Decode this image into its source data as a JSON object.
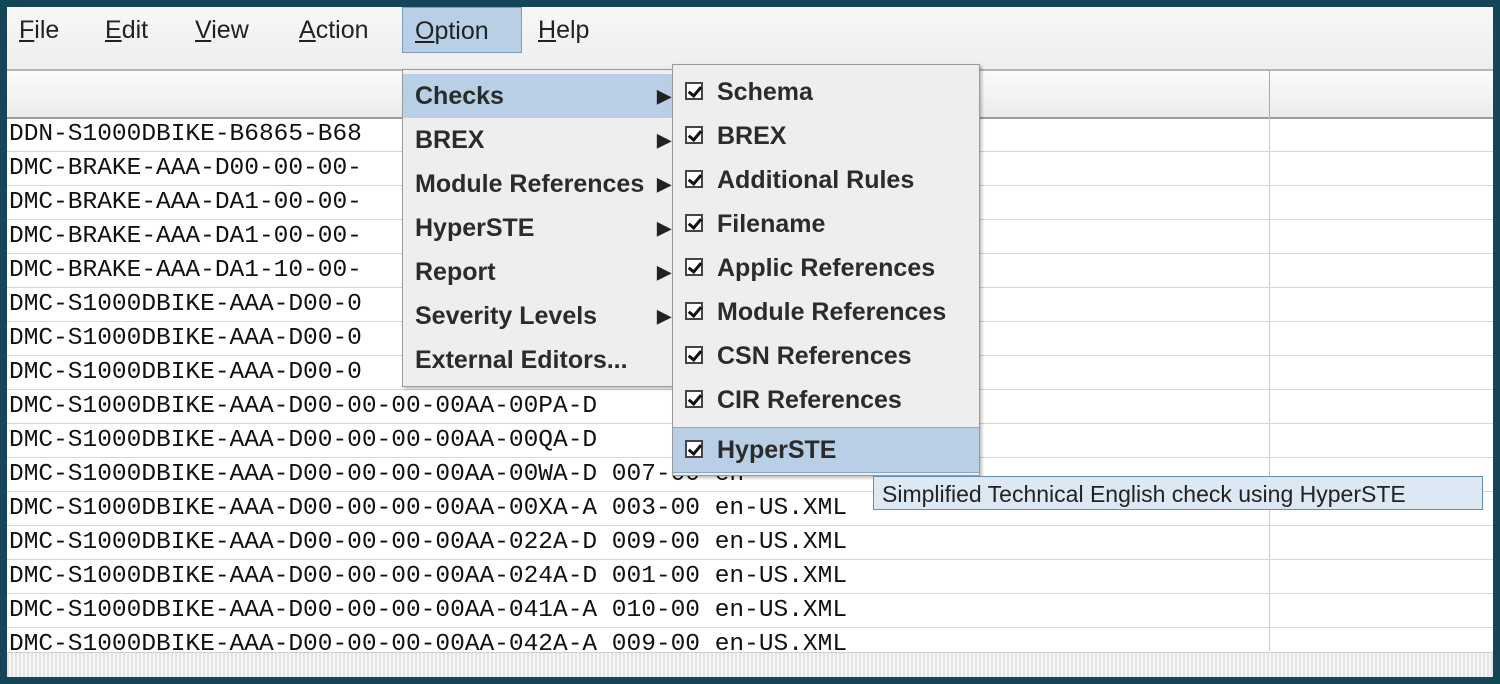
{
  "menubar": {
    "items": [
      {
        "mnemonic": "F",
        "rest": "ile"
      },
      {
        "mnemonic": "E",
        "rest": "dit"
      },
      {
        "mnemonic": "V",
        "rest": "iew"
      },
      {
        "mnemonic": "A",
        "rest": "ction"
      },
      {
        "mnemonic": "O",
        "rest": "ption"
      },
      {
        "mnemonic": "H",
        "rest": "elp"
      }
    ]
  },
  "table": {
    "rows": [
      "DDN-S1000DBIKE-B6865-B68",
      "DMC-BRAKE-AAA-D00-00-00-",
      "DMC-BRAKE-AAA-DA1-00-00-",
      "DMC-BRAKE-AAA-DA1-00-00-",
      "DMC-BRAKE-AAA-DA1-10-00-",
      "DMC-S1000DBIKE-AAA-D00-0",
      "DMC-S1000DBIKE-AAA-D00-0",
      "DMC-S1000DBIKE-AAA-D00-0",
      "DMC-S1000DBIKE-AAA-D00-00-00-00AA-00PA-D",
      "DMC-S1000DBIKE-AAA-D00-00-00-00AA-00QA-D",
      "DMC-S1000DBIKE-AAA-D00-00-00-00AA-00WA-D 007-00 en",
      "DMC-S1000DBIKE-AAA-D00-00-00-00AA-00XA-A 003-00 en-US.XML",
      "DMC-S1000DBIKE-AAA-D00-00-00-00AA-022A-D 009-00 en-US.XML",
      "DMC-S1000DBIKE-AAA-D00-00-00-00AA-024A-D 001-00 en-US.XML",
      "DMC-S1000DBIKE-AAA-D00-00-00-00AA-041A-A 010-00 en-US.XML",
      "DMC-S1000DBIKE-AAA-D00-00-00-00AA-042A-A 009-00 en-US.XML"
    ]
  },
  "option_menu": {
    "items": [
      "Checks",
      "BREX",
      "Module References",
      "HyperSTE",
      "Report",
      "Severity Levels",
      "External Editors..."
    ]
  },
  "checks_menu": {
    "items": [
      "Schema",
      "BREX",
      "Additional Rules",
      "Filename",
      "Applic References",
      "Module References",
      "CSN References",
      "CIR References",
      "HyperSTE"
    ],
    "checked": [
      true,
      true,
      true,
      true,
      true,
      true,
      true,
      true,
      true
    ]
  },
  "tooltip": {
    "text": "Simplified Technical English check using HyperSTE"
  },
  "colors": {
    "frame": "#14465a",
    "highlight": "#b8cfe5",
    "tooltip_bg": "#dde8f5"
  }
}
